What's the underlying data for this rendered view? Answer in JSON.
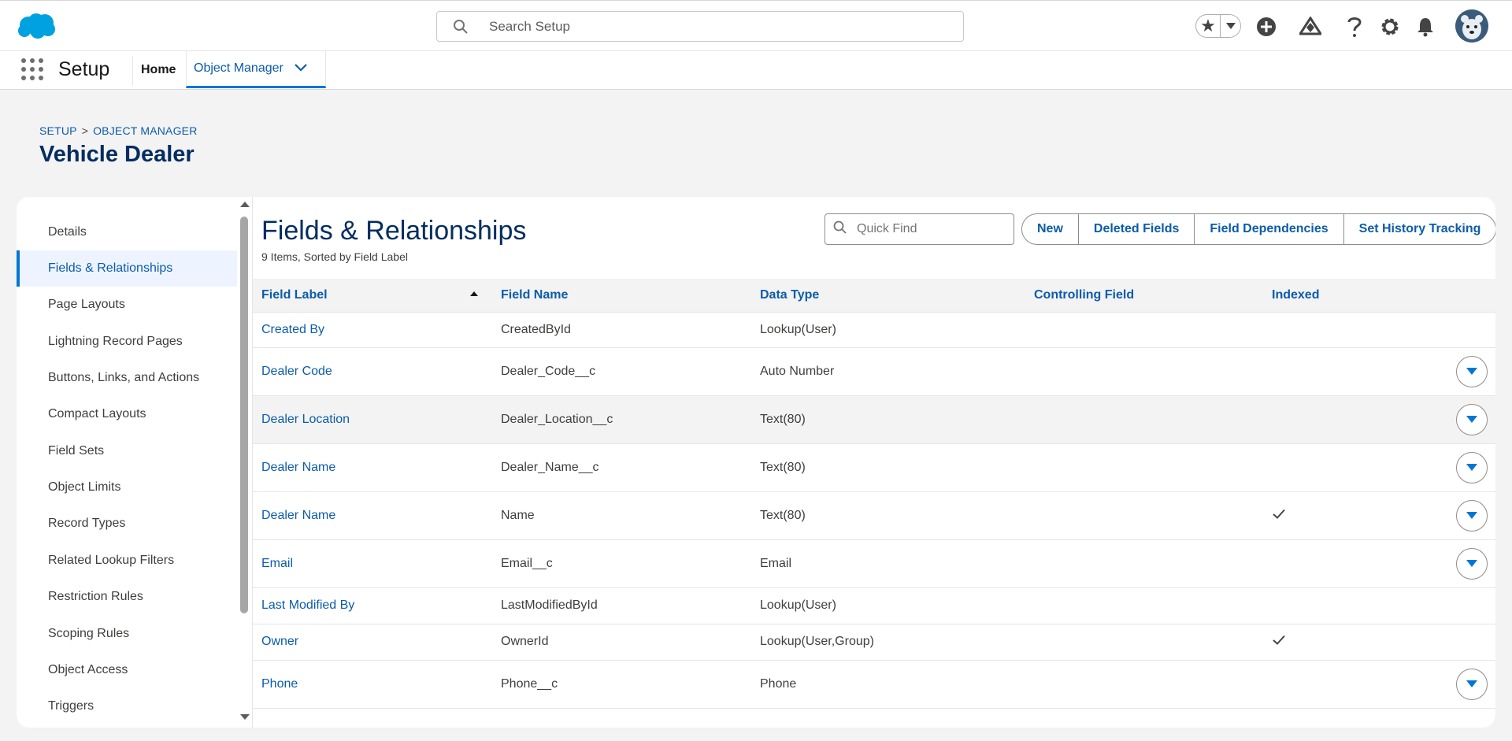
{
  "header": {
    "search_placeholder": "Search Setup",
    "icons": [
      "salesforce-cloud-logo",
      "star-icon",
      "chevron-down-icon",
      "add-icon",
      "trailhead-icon",
      "help-icon",
      "gear-icon",
      "bell-icon",
      "avatar"
    ]
  },
  "nav": {
    "app_name": "Setup",
    "home": "Home",
    "object_manager": "Object Manager"
  },
  "page": {
    "breadcrumb_setup": "SETUP",
    "breadcrumb_sep": ">",
    "breadcrumb_object_manager": "OBJECT MANAGER",
    "title": "Vehicle Dealer"
  },
  "sidebar": {
    "items": [
      {
        "label": "Details"
      },
      {
        "label": "Fields & Relationships"
      },
      {
        "label": "Page Layouts"
      },
      {
        "label": "Lightning Record Pages"
      },
      {
        "label": "Buttons, Links, and Actions"
      },
      {
        "label": "Compact Layouts"
      },
      {
        "label": "Field Sets"
      },
      {
        "label": "Object Limits"
      },
      {
        "label": "Record Types"
      },
      {
        "label": "Related Lookup Filters"
      },
      {
        "label": "Restriction Rules"
      },
      {
        "label": "Scoping Rules"
      },
      {
        "label": "Object Access"
      },
      {
        "label": "Triggers"
      }
    ]
  },
  "section": {
    "title": "Fields & Relationships",
    "subtitle": "9 Items, Sorted by Field Label",
    "quick_find_placeholder": "Quick Find",
    "buttons": {
      "new": "New",
      "deleted_fields": "Deleted Fields",
      "field_dependencies": "Field Dependencies",
      "set_history_tracking": "Set History Tracking"
    }
  },
  "table": {
    "columns": {
      "field_label": "Field Label",
      "field_name": "Field Name",
      "data_type": "Data Type",
      "controlling_field": "Controlling Field",
      "indexed": "Indexed"
    },
    "rows": [
      {
        "label": "Created By",
        "name": "CreatedById",
        "type": "Lookup(User)",
        "controlling": "",
        "indexed": false,
        "actions": false
      },
      {
        "label": "Dealer Code",
        "name": "Dealer_Code__c",
        "type": "Auto Number",
        "controlling": "",
        "indexed": false,
        "actions": true
      },
      {
        "label": "Dealer Location",
        "name": "Dealer_Location__c",
        "type": "Text(80)",
        "controlling": "",
        "indexed": false,
        "actions": true
      },
      {
        "label": "Dealer Name",
        "name": "Dealer_Name__c",
        "type": "Text(80)",
        "controlling": "",
        "indexed": false,
        "actions": true
      },
      {
        "label": "Dealer Name",
        "name": "Name",
        "type": "Text(80)",
        "controlling": "",
        "indexed": true,
        "actions": true
      },
      {
        "label": "Email",
        "name": "Email__c",
        "type": "Email",
        "controlling": "",
        "indexed": false,
        "actions": true
      },
      {
        "label": "Last Modified By",
        "name": "LastModifiedById",
        "type": "Lookup(User)",
        "controlling": "",
        "indexed": false,
        "actions": false
      },
      {
        "label": "Owner",
        "name": "OwnerId",
        "type": "Lookup(User,Group)",
        "controlling": "",
        "indexed": true,
        "actions": false
      },
      {
        "label": "Phone",
        "name": "Phone__c",
        "type": "Phone",
        "controlling": "",
        "indexed": false,
        "actions": true
      }
    ]
  },
  "colors": {
    "brand_blue": "#0176d3",
    "link_blue": "#0b5cab",
    "title_navy": "#032d60",
    "page_bg": "#f3f3f3"
  }
}
